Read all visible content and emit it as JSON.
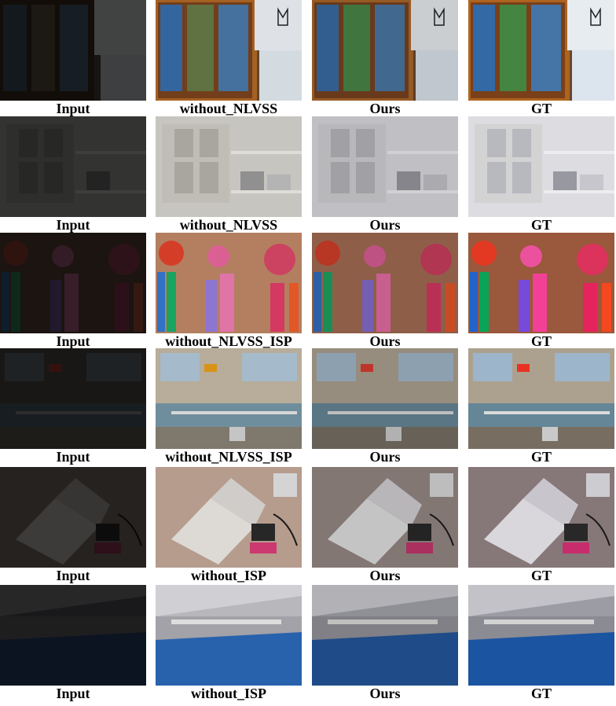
{
  "rows": [
    {
      "scene": "bookshelf-cabinet",
      "captions": [
        "Input",
        "without_NLVSS",
        "Ours",
        "GT"
      ]
    },
    {
      "scene": "white-cupboard",
      "captions": [
        "Input",
        "without_NLVSS",
        "Ours",
        "GT"
      ]
    },
    {
      "scene": "tassel-ornaments",
      "captions": [
        "Input",
        "without_NLVSS_ISP",
        "Ours",
        "GT"
      ]
    },
    {
      "scene": "swimming-pool",
      "captions": [
        "Input",
        "without_NLVSS_ISP",
        "Ours",
        "GT"
      ]
    },
    {
      "scene": "open-book-desk",
      "captions": [
        "Input",
        "without_ISP",
        "Ours",
        "GT"
      ]
    },
    {
      "scene": "indoor-hall",
      "captions": [
        "Input",
        "without_ISP",
        "Ours",
        "GT"
      ]
    }
  ],
  "colors": {
    "background": "#ffffff",
    "caption": "#000000"
  }
}
